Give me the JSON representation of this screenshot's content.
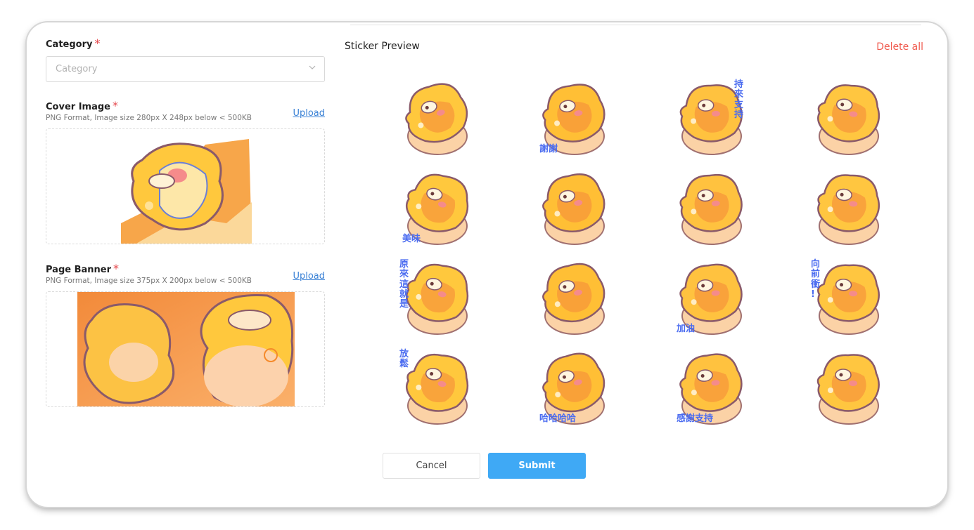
{
  "form": {
    "category": {
      "label": "Category",
      "required": "*",
      "placeholder": "Category"
    },
    "cover": {
      "label": "Cover Image",
      "required": "*",
      "hint": "PNG Format, Image size 280px X 248px below < 500KB",
      "upload": "Upload"
    },
    "banner": {
      "label": "Page Banner",
      "required": "*",
      "hint": "PNG Format, Image size 375px X 200px below < 500KB",
      "upload": "Upload"
    }
  },
  "preview": {
    "title": "Sticker Preview",
    "delete_all": "Delete all",
    "stickers": [
      {
        "caption": ""
      },
      {
        "caption": "謝謝"
      },
      {
        "caption": "持\n來\n支\n持"
      },
      {
        "caption": ""
      },
      {
        "caption": "美味"
      },
      {
        "caption": ""
      },
      {
        "caption": ""
      },
      {
        "caption": ""
      },
      {
        "caption": "原\n來\n這\n就\n是"
      },
      {
        "caption": ""
      },
      {
        "caption": "加油"
      },
      {
        "caption": "向\n前\n衝\n!"
      },
      {
        "caption": "放\n鬆"
      },
      {
        "caption": "哈哈哈哈"
      },
      {
        "caption": "感謝支持"
      },
      {
        "caption": ""
      }
    ]
  },
  "actions": {
    "cancel": "Cancel",
    "submit": "Submit"
  },
  "colors": {
    "accent": "#3fa9f5",
    "danger": "#f05b4f",
    "link": "#3b82d6",
    "required": "#e5484d"
  }
}
